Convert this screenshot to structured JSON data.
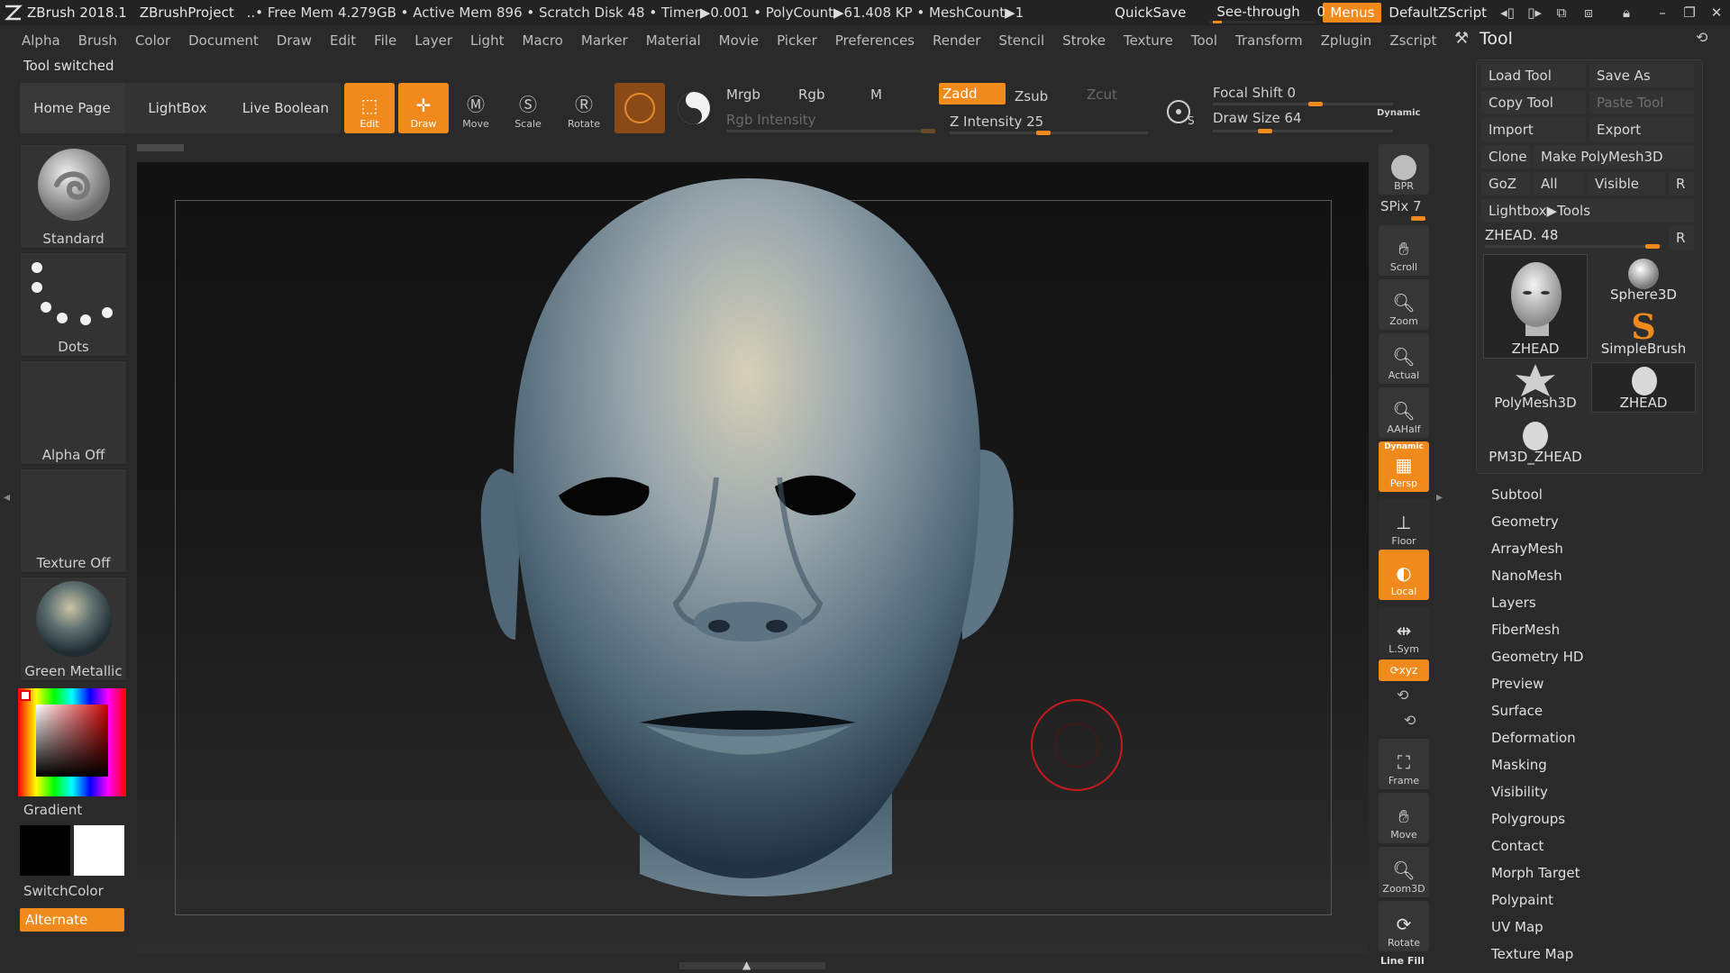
{
  "titlebar": {
    "app": "ZBrush 2018.1",
    "project": "ZBrushProject",
    "info": "..• Free Mem 4.279GB • Active Mem 896 • Scratch Disk 48 •  Timer▶0.001 • PolyCount▶61.408 KP  • MeshCount▶1",
    "quicksave": "QuickSave",
    "seethrough": "See-through",
    "seethrough_value": "0",
    "menus": "Menus",
    "script": "DefaultZScript"
  },
  "menubar": {
    "items": [
      "Alpha",
      "Brush",
      "Color",
      "Document",
      "Draw",
      "Edit",
      "File",
      "Layer",
      "Light",
      "Macro",
      "Marker",
      "Material",
      "Movie",
      "Picker",
      "Preferences",
      "Render",
      "Stencil",
      "Stroke",
      "Texture",
      "Tool",
      "Transform",
      "Zplugin",
      "Zscript"
    ]
  },
  "status": "Tool switched",
  "toolbar": {
    "home": "Home Page",
    "lightbox": "LightBox",
    "liveboolean": "Live Boolean",
    "edit": "Edit",
    "draw": "Draw",
    "move": "Move",
    "scale": "Scale",
    "rotate": "Rotate",
    "mrgb": "Mrgb",
    "rgb": "Rgb",
    "m": "M",
    "zadd": "Zadd",
    "zsub": "Zsub",
    "zcut": "Zcut",
    "rgb_intensity": "Rgb Intensity",
    "z_intensity": "Z Intensity 25",
    "focal_shift": "Focal Shift 0",
    "draw_size": "Draw Size 64",
    "dynamic": "Dynamic"
  },
  "leftpanel": {
    "brush": "Standard",
    "stroke": "Dots",
    "alpha": "Alpha Off",
    "texture": "Texture Off",
    "material": "Green Metallic",
    "gradient": "Gradient",
    "switchcolor": "SwitchColor",
    "alternate": "Alternate"
  },
  "shelf": {
    "bpr": "BPR",
    "spix": "SPix 7",
    "scroll": "Scroll",
    "zoom": "Zoom",
    "actual": "Actual",
    "aahalf": "AAHalf",
    "persp": "Persp",
    "persp_tag": "Dynamic",
    "floor": "Floor",
    "local": "Local",
    "lsym": "L.Sym",
    "xyz": "⟳xyz",
    "frame": "Frame",
    "move": "Move",
    "zoom3d": "Zoom3D",
    "rotate": "Rotate",
    "linefill": "Line Fill"
  },
  "toolpanel": {
    "title": "Tool",
    "load": "Load Tool",
    "saveas": "Save As",
    "copy": "Copy Tool",
    "paste": "Paste Tool",
    "import": "Import",
    "export": "Export",
    "clone": "Clone",
    "makepoly": "Make PolyMesh3D",
    "goz": "GoZ",
    "all": "All",
    "visible": "Visible",
    "r": "R",
    "lightbox_tools": "Lightbox▶Tools",
    "zhead_slider": "ZHEAD. 48",
    "thumbs": [
      "ZHEAD",
      "Sphere3D",
      "SimpleBrush",
      "PolyMesh3D",
      "ZHEAD",
      "PM3D_ZHEAD"
    ],
    "sections": [
      "Subtool",
      "Geometry",
      "ArrayMesh",
      "NanoMesh",
      "Layers",
      "FiberMesh",
      "Geometry HD",
      "Preview",
      "Surface",
      "Deformation",
      "Masking",
      "Visibility",
      "Polygroups",
      "Contact",
      "Morph Target",
      "Polypaint",
      "UV Map",
      "Texture Map"
    ]
  },
  "colors": {
    "accent": "#f08a1c",
    "bg": "#2a2a2a",
    "brush_cursor": "#c8191e"
  }
}
